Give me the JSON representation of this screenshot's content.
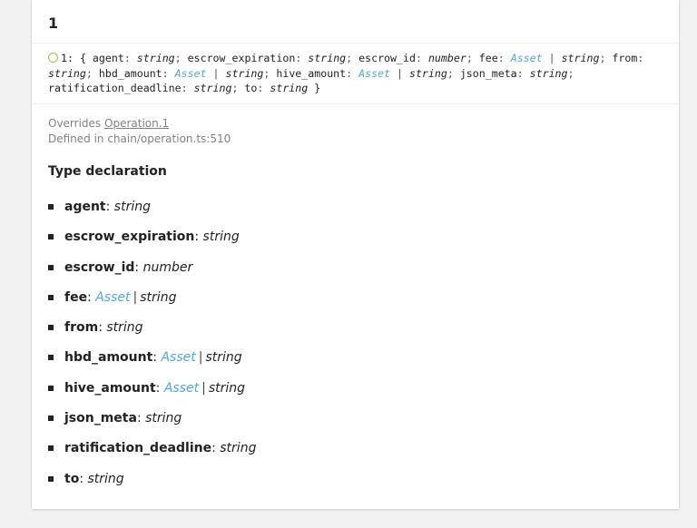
{
  "member": {
    "title": "1"
  },
  "signature": {
    "prefix": "1: { ",
    "members": [
      {
        "name": "agent",
        "types": [
          {
            "text": "string",
            "link": false
          }
        ]
      },
      {
        "name": "escrow_expiration",
        "types": [
          {
            "text": "string",
            "link": false
          }
        ]
      },
      {
        "name": "escrow_id",
        "types": [
          {
            "text": "number",
            "link": false
          }
        ]
      },
      {
        "name": "fee",
        "types": [
          {
            "text": "Asset",
            "link": true
          },
          {
            "text": "string",
            "link": false
          }
        ]
      },
      {
        "name": "from",
        "types": [
          {
            "text": "string",
            "link": false
          }
        ]
      },
      {
        "name": "hbd_amount",
        "types": [
          {
            "text": "Asset",
            "link": true
          },
          {
            "text": "string",
            "link": false
          }
        ]
      },
      {
        "name": "hive_amount",
        "types": [
          {
            "text": "Asset",
            "link": true
          },
          {
            "text": "string",
            "link": false
          }
        ]
      },
      {
        "name": "json_meta",
        "types": [
          {
            "text": "string",
            "link": false
          }
        ]
      },
      {
        "name": "ratification_deadline",
        "types": [
          {
            "text": "string",
            "link": false
          }
        ]
      },
      {
        "name": "to",
        "types": [
          {
            "text": "string",
            "link": false
          }
        ]
      }
    ],
    "suffix": " }"
  },
  "sources": {
    "overrides_label": "Overrides ",
    "overrides_link": "Operation.1",
    "defined_in": "Defined in chain/operation.ts:510"
  },
  "type_declaration": {
    "title": "Type declaration",
    "params": [
      {
        "name": "agent",
        "types": [
          {
            "text": "string",
            "link": false
          }
        ]
      },
      {
        "name": "escrow_expiration",
        "types": [
          {
            "text": "string",
            "link": false
          }
        ]
      },
      {
        "name": "escrow_id",
        "types": [
          {
            "text": "number",
            "link": false
          }
        ]
      },
      {
        "name": "fee",
        "types": [
          {
            "text": "Asset",
            "link": true
          },
          {
            "text": "string",
            "link": false
          }
        ]
      },
      {
        "name": "from",
        "types": [
          {
            "text": "string",
            "link": false
          }
        ]
      },
      {
        "name": "hbd_amount",
        "types": [
          {
            "text": "Asset",
            "link": true
          },
          {
            "text": "string",
            "link": false
          }
        ]
      },
      {
        "name": "hive_amount",
        "types": [
          {
            "text": "Asset",
            "link": true
          },
          {
            "text": "string",
            "link": false
          }
        ]
      },
      {
        "name": "json_meta",
        "types": [
          {
            "text": "string",
            "link": false
          }
        ]
      },
      {
        "name": "ratification_deadline",
        "types": [
          {
            "text": "string",
            "link": false
          }
        ]
      },
      {
        "name": "to",
        "types": [
          {
            "text": "string",
            "link": false
          }
        ]
      }
    ]
  },
  "colors": {
    "link": "#4da6ea",
    "signature_marker": "#9cc43f",
    "muted": "#808080"
  }
}
